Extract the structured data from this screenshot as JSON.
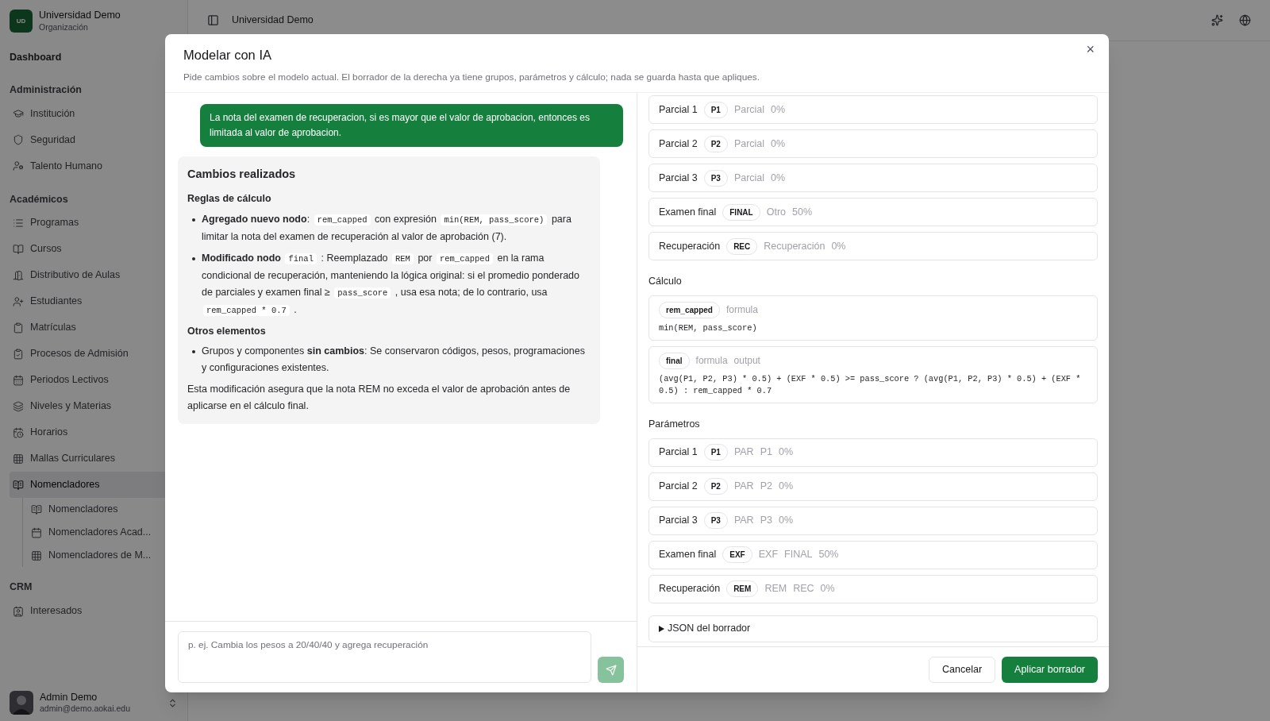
{
  "sidebar": {
    "brand": {
      "logo": "UD",
      "name": "Universidad Demo",
      "subtitle": "Organización"
    },
    "top_item": {
      "label": "Dashboard",
      "selected": false
    },
    "sections": [
      {
        "title": "Administración",
        "items": [
          {
            "label": "Institución",
            "selected": false
          },
          {
            "label": "Seguridad",
            "selected": false
          },
          {
            "label": "Talento Humano",
            "selected": false
          }
        ]
      },
      {
        "title": "Académicos",
        "items": [
          {
            "label": "Programas",
            "selected": false
          },
          {
            "label": "Cursos",
            "selected": false
          },
          {
            "label": "Distributivo de Aulas",
            "selected": false
          },
          {
            "label": "Estudiantes",
            "selected": false
          },
          {
            "label": "Matrículas",
            "selected": false
          },
          {
            "label": "Procesos de Admisión",
            "selected": false
          },
          {
            "label": "Periodos Lectivos",
            "selected": false
          },
          {
            "label": "Niveles y Materias",
            "selected": false
          },
          {
            "label": "Horarios",
            "selected": false
          },
          {
            "label": "Mallas Curriculares",
            "selected": false
          },
          {
            "label": "Nomencladores",
            "selected": true,
            "expanded": true,
            "children": [
              {
                "label": "Nomencladores",
                "selected": false
              },
              {
                "label": "Nomencladores Acad...",
                "selected": false
              },
              {
                "label": "Nomencladores de M...",
                "selected": false
              }
            ]
          }
        ]
      },
      {
        "title": "CRM",
        "items": [
          {
            "label": "Interesados",
            "selected": false
          }
        ]
      }
    ],
    "user": {
      "name": "Admin Demo",
      "email": "admin@demo.aokai.edu"
    }
  },
  "topbar": {
    "title": "Universidad Demo"
  },
  "dialog": {
    "title": "Modelar con IA",
    "description": "Pide cambios sobre el modelo actual. El borrador de la derecha ya tiene grupos, parámetros y cálculo; nada se guarda hasta que apliques.",
    "messages": [
      {
        "kind": "user",
        "text": "La nota del examen de recuperacion, si es mayor que el valor de aprobacion, entonces es limitada al valor de aprobacion."
      },
      {
        "kind": "assistant",
        "heading": "Cambios realizados",
        "blocks": [
          {
            "kind": "subheading",
            "text": "Reglas de cálculo"
          },
          {
            "kind": "bullet",
            "parts": [
              {
                "kind": "bold",
                "text": "Agregado nuevo nodo"
              },
              {
                "kind": "text",
                "text": ": "
              },
              {
                "kind": "code",
                "text": "rem_capped"
              },
              {
                "kind": "text",
                "text": " con expresión "
              },
              {
                "kind": "code",
                "text": "min(REM, pass_score)"
              },
              {
                "kind": "text",
                "text": " para limitar la nota del examen de recuperación al valor de aprobación (7)."
              }
            ]
          },
          {
            "kind": "bullet",
            "parts": [
              {
                "kind": "bold",
                "text": "Modificado nodo "
              },
              {
                "kind": "code",
                "text": "final"
              },
              {
                "kind": "text",
                "text": " : Reemplazado "
              },
              {
                "kind": "code",
                "text": "REM"
              },
              {
                "kind": "text",
                "text": " por "
              },
              {
                "kind": "code",
                "text": "rem_capped"
              },
              {
                "kind": "text",
                "text": " en la rama condicional de recuperación, manteniendo la lógica original: si el promedio ponderado de parciales y examen final ≥ "
              },
              {
                "kind": "code",
                "text": "pass_score"
              },
              {
                "kind": "text",
                "text": " , usa esa nota; de lo contrario, usa "
              },
              {
                "kind": "code",
                "text": "rem_capped * 0.7"
              },
              {
                "kind": "text",
                "text": " ."
              }
            ]
          },
          {
            "kind": "subheading",
            "text": "Otros elementos"
          },
          {
            "kind": "bullet",
            "parts": [
              {
                "kind": "text",
                "text": "Grupos y componentes "
              },
              {
                "kind": "bold",
                "text": "sin cambios"
              },
              {
                "kind": "text",
                "text": ": Se conservaron códigos, pesos, programaciones y configuraciones existentes."
              }
            ]
          },
          {
            "kind": "paragraph",
            "parts": [
              {
                "kind": "text",
                "text": "Esta modificación asegura que la nota REM no exceda el valor de aprobación antes de aplicarse en el cálculo final."
              }
            ]
          }
        ]
      }
    ],
    "composer": {
      "placeholder": "p. ej. Cambia los pesos a 20/40/40 y agrega recuperación",
      "send_disabled": true
    },
    "groups": [
      {
        "name": "Parcial 1",
        "code": "P1",
        "meta": [
          "Parcial",
          "0%"
        ]
      },
      {
        "name": "Parcial 2",
        "code": "P2",
        "meta": [
          "Parcial",
          "0%"
        ]
      },
      {
        "name": "Parcial 3",
        "code": "P3",
        "meta": [
          "Parcial",
          "0%"
        ]
      },
      {
        "name": "Examen final",
        "code": "FINAL",
        "meta": [
          "Otro",
          "50%"
        ]
      },
      {
        "name": "Recuperación",
        "code": "REC",
        "meta": [
          "Recuperación",
          "0%"
        ]
      }
    ],
    "calculation": {
      "title": "Cálculo",
      "nodes": [
        {
          "name": "rem_capped",
          "tags": [
            "formula"
          ],
          "expression": "min(REM, pass_score)"
        },
        {
          "name": "final",
          "tags": [
            "formula",
            "output"
          ],
          "expression": "(avg(P1, P2, P3) * 0.5) + (EXF * 0.5) >= pass_score ? (avg(P1, P2, P3) * 0.5) + (EXF * 0.5) : rem_capped * 0.7"
        }
      ]
    },
    "parameters": {
      "title": "Parámetros",
      "items": [
        {
          "name": "Parcial 1",
          "code": "P1",
          "meta": [
            "PAR",
            "P1",
            "0%"
          ]
        },
        {
          "name": "Parcial 2",
          "code": "P2",
          "meta": [
            "PAR",
            "P2",
            "0%"
          ]
        },
        {
          "name": "Parcial 3",
          "code": "P3",
          "meta": [
            "PAR",
            "P3",
            "0%"
          ]
        },
        {
          "name": "Examen final",
          "code": "EXF",
          "meta": [
            "EXF",
            "FINAL",
            "50%"
          ]
        },
        {
          "name": "Recuperación",
          "code": "REM",
          "meta": [
            "REM",
            "REC",
            "0%"
          ]
        }
      ]
    },
    "json_toggle": {
      "label": "JSON del borrador",
      "expanded": false
    },
    "buttons": {
      "cancel": "Cancelar",
      "apply": "Aplicar borrador"
    },
    "close": "×"
  }
}
